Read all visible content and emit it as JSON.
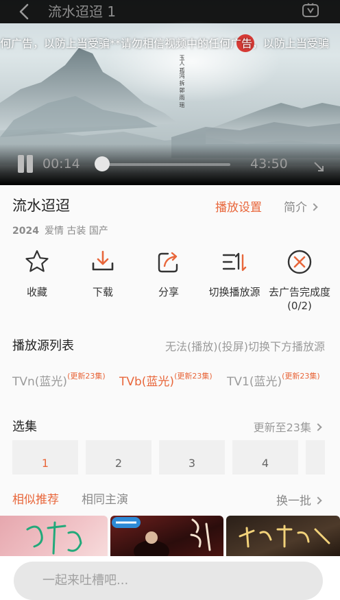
{
  "player": {
    "title": "流水迢迢 1",
    "marquee": "何广告，以防上当受骗**请勿相信视频中的任何广告，以防上当受骗",
    "poem_text": "玉人 孤鸿 拆 郭 雨 瑶",
    "current_time": "00:14",
    "total_time": "43:50",
    "progress": 0.005,
    "icons": {
      "back": "back-arrow-icon",
      "tv": "tv-cast-icon",
      "pause": "pause-icon",
      "fullscreen": "fullscreen-icon"
    }
  },
  "info": {
    "title": "流水迢迢",
    "play_settings": "播放设置",
    "intro": "简介",
    "year": "2024",
    "tags": "爱情 古装 国产"
  },
  "actions": [
    {
      "label": "收藏",
      "icon": "star-icon"
    },
    {
      "label": "下载",
      "icon": "download-icon"
    },
    {
      "label": "分享",
      "icon": "share-icon"
    },
    {
      "label": "切换播放源",
      "icon": "switch-source-icon"
    },
    {
      "label": "去广告完成度",
      "sub": "(0/2)",
      "icon": "remove-ad-icon"
    }
  ],
  "sources": {
    "title": "播放源列表",
    "hint": "无法(播放)(投屏)切换下方播放源",
    "items": [
      {
        "name": "TVn(蓝光)",
        "badge": "(更新23集)"
      },
      {
        "name": "TVb(蓝光)",
        "badge": "(更新23集)"
      },
      {
        "name": "TV1(蓝光)",
        "badge": "(更新23集)"
      }
    ]
  },
  "episodes": {
    "title": "选集",
    "update": "更新至23集",
    "items": [
      "1",
      "2",
      "3",
      "4"
    ]
  },
  "recommend": {
    "tab_similar": "相似推荐",
    "tab_cast": "相同主演",
    "refresh": "换一批"
  },
  "comment": {
    "placeholder": "一起来吐槽吧..."
  },
  "colors": {
    "accent": "#e8663a",
    "text": "#222222",
    "muted": "#8a8a8a"
  }
}
